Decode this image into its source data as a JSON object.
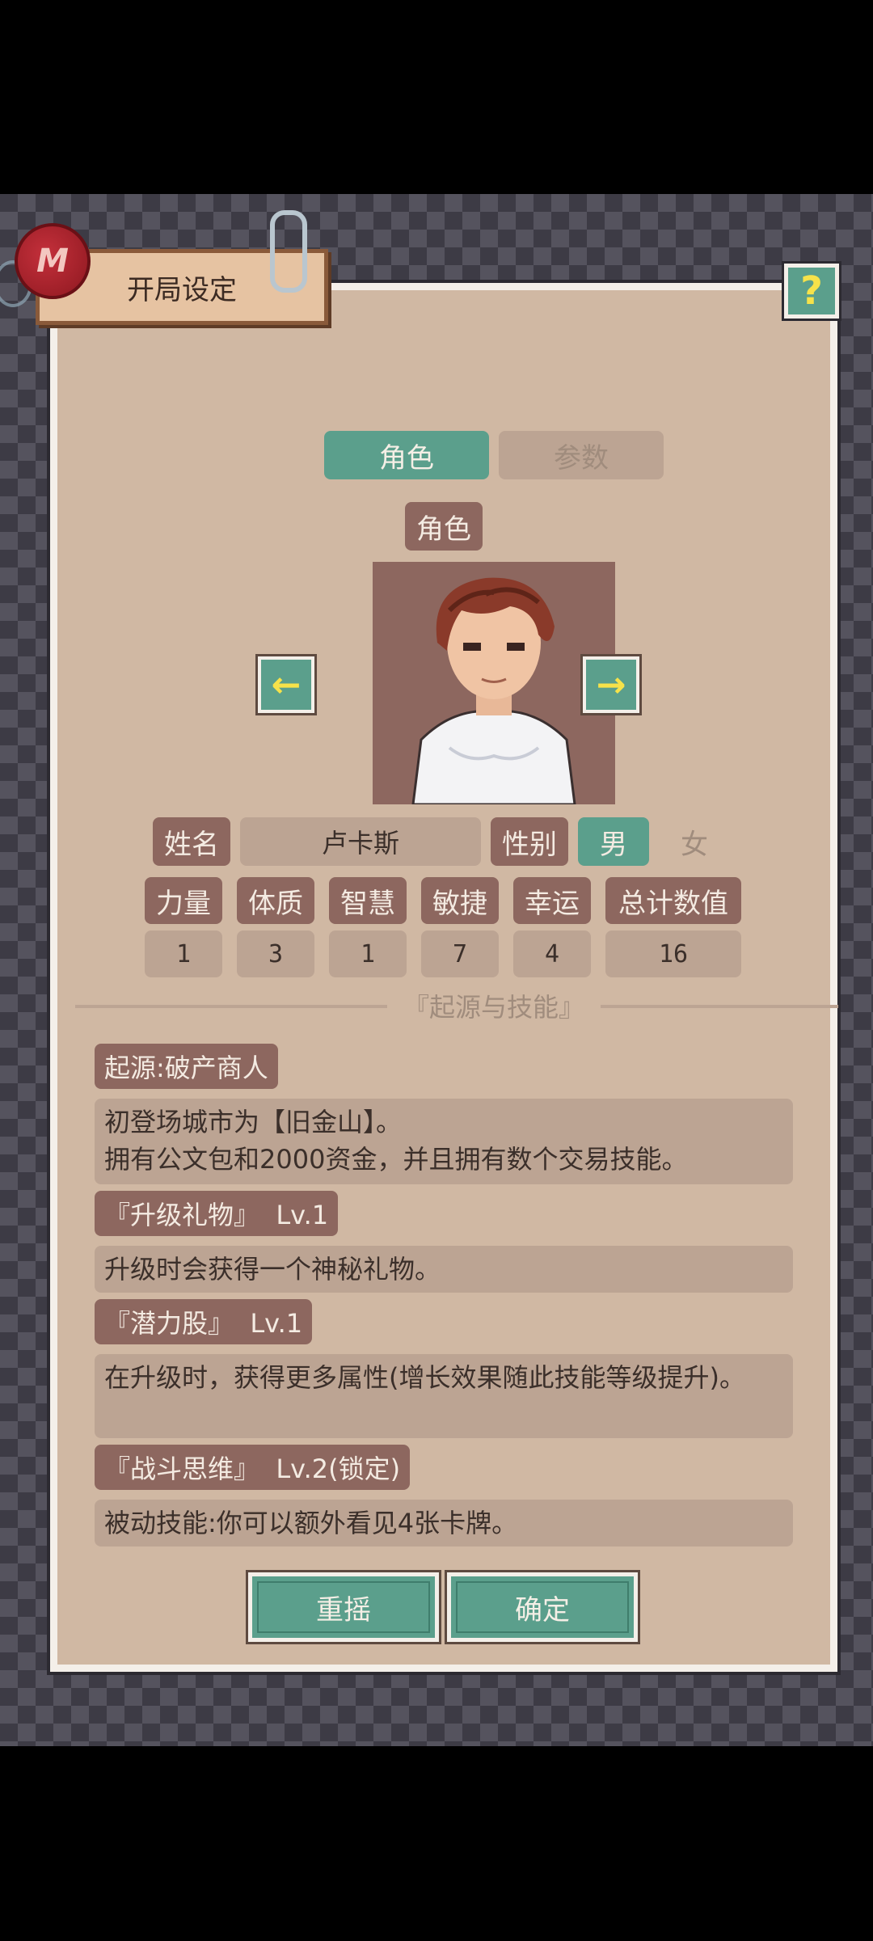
{
  "header": {
    "title": "开局设定",
    "seal_letter": "M",
    "help": "?"
  },
  "tabs": [
    {
      "label": "角色"
    },
    {
      "label": "参数"
    }
  ],
  "character": {
    "section_label": "角色",
    "left_arrow": "←",
    "right_arrow": "→",
    "name_label": "姓名",
    "name_value": "卢卡斯",
    "gender_label": "性别",
    "gender_male": "男",
    "gender_female": "女",
    "gender_selected": "男"
  },
  "stats": {
    "headers": [
      "力量",
      "体质",
      "智慧",
      "敏捷",
      "幸运",
      "总计数值"
    ],
    "values": [
      "1",
      "3",
      "1",
      "7",
      "4",
      "16"
    ]
  },
  "origin": {
    "section_title": "『起源与技能』",
    "origin_label": "起源:破产商人",
    "origin_desc_line1": "初登场城市为【旧金山】。",
    "origin_desc_line2": "拥有公文包和2000资金，并且拥有数个交易技能。",
    "skills": [
      {
        "name": "『升级礼物』  Lv.1",
        "desc": "升级时会获得一个神秘礼物。"
      },
      {
        "name": "『潜力股』  Lv.1",
        "desc": "在升级时，获得更多属性(增长效果随此技能等级提升)。"
      },
      {
        "name": "『战斗思维』  Lv.2(锁定)",
        "desc": "被动技能:你可以额外看见4张卡牌。"
      }
    ]
  },
  "buttons": {
    "reroll": "重摇",
    "confirm": "确定"
  },
  "colors": {
    "accent": "#5b9f8c",
    "chip": "#8d675f",
    "panel": "#d0b8a3",
    "arrow": "#f6e24a"
  }
}
